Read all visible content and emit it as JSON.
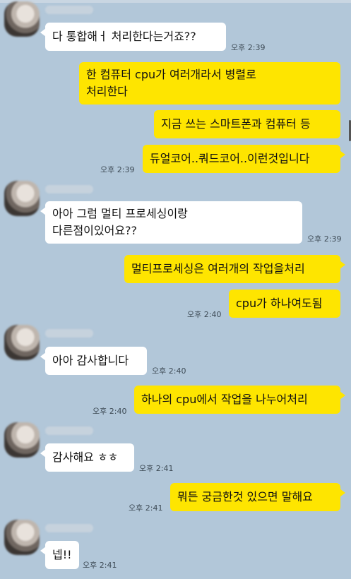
{
  "messages": [
    {
      "from": "other",
      "lines": [
        "다 통합해ㅓ 처리한다는거죠??"
      ],
      "time": "오후 2:39"
    },
    {
      "from": "me",
      "lines": [
        "한 컴퓨터 cpu가 여러개라서 병렬로",
        "처리한다"
      ],
      "time": ""
    },
    {
      "from": "me",
      "lines": [
        "지금 쓰는 스마트폰과 컴퓨터 등"
      ],
      "time": ""
    },
    {
      "from": "me",
      "lines": [
        "듀얼코어..쿼드코어..이런것입니다"
      ],
      "time": "오후 2:39"
    },
    {
      "from": "other",
      "lines": [
        "아아 그럼 멀티 프로세싱이랑",
        "다른점이있어요??"
      ],
      "time": "오후 2:39"
    },
    {
      "from": "me",
      "lines": [
        "멀티프로세싱은 여러개의 작업을처리"
      ],
      "time": ""
    },
    {
      "from": "me",
      "lines": [
        "cpu가 하나여도됨"
      ],
      "time": "오후 2:40"
    },
    {
      "from": "other",
      "lines": [
        "아아 감사합니다"
      ],
      "time": "오후 2:40"
    },
    {
      "from": "me",
      "lines": [
        "하나의 cpu에서 작업을 나누어처리"
      ],
      "time": "오후 2:40"
    },
    {
      "from": "other",
      "lines": [
        "감사해요 ㅎㅎ"
      ],
      "time": "오후 2:41"
    },
    {
      "from": "me",
      "lines": [
        "뭐든 궁금한것 있으면 말해요"
      ],
      "time": "오후 2:41"
    },
    {
      "from": "other",
      "lines": [
        "넵!!"
      ],
      "time": "오후 2:41"
    }
  ],
  "colors": {
    "background": "#b2c7d9",
    "incoming": "#ffffff",
    "outgoing": "#fee500"
  }
}
